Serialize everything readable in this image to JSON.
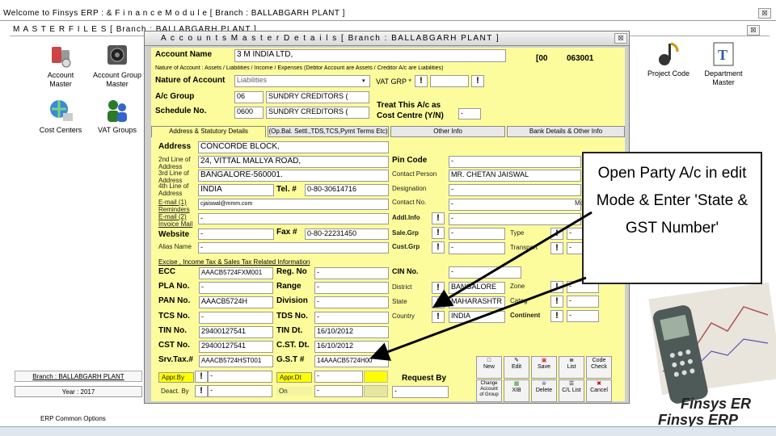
{
  "outer_window": {
    "title": "Welcome to Finsys ERP :  & F i n a n c e   M o d u l e        [ Branch : BALLABGARH PLANT ]",
    "close": "☒"
  },
  "master_window": {
    "title": "M A S T E R   F I L E S        [ Branch : BALLABGARH PLANT ]",
    "close": "☒"
  },
  "desktop_icons": [
    {
      "label": "Account\nMaster"
    },
    {
      "label": "Account Group\nMaster"
    },
    {
      "label": "Cost Centers"
    },
    {
      "label": "VAT Groups"
    },
    {
      "label": "Project Code"
    },
    {
      "label": "Department\nMaster"
    }
  ],
  "left_panel": {
    "branch_btn": "Branch : BALLABGARH PLANT",
    "year_btn": "Year : 2017",
    "erp_options": "ERP Common Options"
  },
  "dialog": {
    "title": "A c c o u n t s   M a s t e r   D e t a i l s       [ Branch : BALLABGARH PLANT ]",
    "account_name_label": "Account Name",
    "account_name_value": "3 M  INDIA LTD,",
    "account_code_prefix": "[00",
    "account_code": "063001",
    "nature_hint": "Nature of Account : Assets / Liabilities / Income / Expenses (Debtor Account are Assets / Creditor A/c are Liabilities)",
    "nature_label": "Nature of Account",
    "nature_value": "Liabilities",
    "vat_grp_label": "VAT GRP *",
    "ac_group_label": "A/c Group",
    "ac_group_code": "06",
    "ac_group_name": "SUNDRY CREDITORS (",
    "schedule_label": "Schedule No.",
    "schedule_code": "0600",
    "schedule_name": "SUNDRY CREDITORS (",
    "treat_label": "Treat This A/c as\nCost Centre (Y/N)",
    "treat_value": "-",
    "tabs": [
      "Address & Statutory Details",
      "(Op.Bal. Settl.,TDS,TCS,Pymt Terms Etc)",
      "Other Info",
      "Bank Details & Other Info"
    ],
    "address_label": "Address",
    "address_lines": [
      "CONCORDE BLOCK,",
      "24, VITTAL MALLYA ROAD,",
      "BANGALORE-560001.",
      "INDIA"
    ],
    "line2_label": "2nd Line of\nAddress",
    "line3_label": "3rd Line of\nAddress",
    "line4_label": "4th Line of\nAddress",
    "tel_label": "Tel. #",
    "tel_value": "0-80-30614716",
    "email1_label": "E-mail (1)\nReminders",
    "email1_value": "cjaiswal@mmm.com",
    "email2_label": "E-mail (2)\nInvoice Mail",
    "email2_value": "-",
    "website_label": "Website",
    "website_value": "-",
    "fax_label": "Fax #",
    "fax_value": "0-80-22231450",
    "alias_label": "Alias Name",
    "alias_value": "-",
    "pin_label": "Pin Code",
    "pin_value": "-",
    "contact_label": "Contact Person",
    "contact_value": "MR. CHETAN JAISWAL",
    "designation_label": "Designation",
    "designation_value": "-",
    "contact_no_label": "Contact No.",
    "contact_no_value": "-",
    "addl_label": "Addl.Info",
    "addl_value": "-",
    "more_details": "More Details",
    "salegrp_label": "Sale.Grp",
    "salegrp_value": "-",
    "custgrp_label": "Cust.Grp",
    "custgrp_value": "-",
    "type_label": "Type",
    "type_value": "-",
    "transport_label": "Transport",
    "transport_value": "-",
    "excise_section": "Excise , Income Tax & Sales Tax Related Information",
    "ecc_label": "ECC",
    "ecc_value": "AAACB5724FXM001",
    "regno_label": "Reg. No",
    "regno_value": "-",
    "pla_label": "PLA No.",
    "pla_value": "-",
    "range_label": "Range",
    "range_value": "-",
    "pan_label": "PAN No.",
    "pan_value": "AAACB5724H",
    "division_label": "Division",
    "division_value": "-",
    "tcs_label": "TCS No.",
    "tcs_value": "-",
    "tds_label": "TDS No.",
    "tds_value": "-",
    "tin_label": "TIN No.",
    "tin_value": "29400127541",
    "tindt_label": "TIN Dt.",
    "tindt_value": "16/10/2012",
    "cst_label": "CST No.",
    "cst_value": "29400127541",
    "cstdt_label": "C.ST. Dt.",
    "cstdt_value": "16/10/2012",
    "srvtax_label": "Srv.Tax.#",
    "srvtax_value": "AAACB5724HST001",
    "gst_label": "G.S.T #",
    "gst_value": "14AAACB5724H00",
    "cin_label": "CIN No.",
    "cin_value": "-",
    "district_label": "District",
    "district_value": "BANGALORE",
    "zone_label": "Zone",
    "zone_value": "-",
    "state_label": "State",
    "state_value": "MAHARASHTR",
    "categ_label": "Categ",
    "categ_value": "-",
    "country_label": "Country",
    "country_value": "INDIA",
    "continent_label": "Continent",
    "continent_value": "-",
    "appr_by_label": "Appr.By",
    "appr_by_value": "-",
    "appr_dt_label": "Appr.Dt",
    "appr_dt_value": "-",
    "deact_label": "Deact. By",
    "deact_value": "-",
    "on_label": "On",
    "on_value": "-",
    "request_label": "Request By",
    "request_value": "-",
    "toolbar": [
      "New",
      "Edit",
      "Save",
      "List",
      "Code\nCheck",
      "Change\nAccount\nof Group",
      "XIB",
      "Delete",
      "C/L List",
      "Cancel"
    ],
    "info_btn": "!"
  },
  "callout": {
    "text": "Open Party A/c in edit Mode & Enter 'State & GST Number'"
  },
  "brand": {
    "text1": "Finsys ER",
    "text2": "Finsys ERP"
  },
  "colors": {
    "yellow": "#fdfc9c",
    "gst_highlight": "#ffff00"
  }
}
